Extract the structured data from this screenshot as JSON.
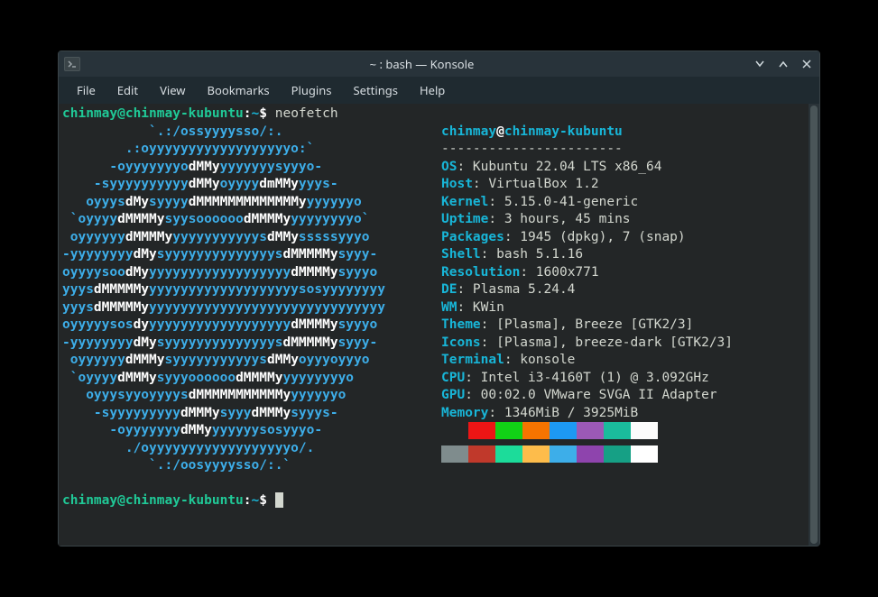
{
  "titlebar": {
    "title": "~ : bash — Konsole"
  },
  "menubar": {
    "items": [
      "File",
      "Edit",
      "View",
      "Bookmarks",
      "Plugins",
      "Settings",
      "Help"
    ]
  },
  "prompt": {
    "user": "chinmay",
    "at": "@",
    "host": "chinmay-kubuntu",
    "colon": ":",
    "path": "~",
    "dollar": "$ ",
    "command": "neofetch"
  },
  "ascii": [
    "           `.:/ossyyyysso/:.               ",
    "        .:oyyyyyyyyyyyyyyyyyyo:`           ",
    "      -oyyyyyyyo|dMMy|yyyyyyysyyyo-        ",
    "    -syyyyyyyyyy|dMMy|oyyyy|dmMMy|yyys-    ",
    "   oyyys|dMy|syyyy|dMMMMMMMMMMMMMy|yyyyyyo ",
    " `oyyyy|dMMMMy|syysoooooo|dMMMMy|yyyyyyyyo`",
    " oyyyyyy|dMMMMy|yyyyyyyyyyys|dMMy|sssssyyyo",
    "-yyyyyyyy|dMy|syyyyyyyyyyyyyys|dMMMMMy|syyy-",
    "oyyyysoo|dMy|yyyyyyyyyyyyyyyyyy|dMMMMy|syyyo",
    "yyys|dMMMMMy|yyyyyyyyyyyyyyyyyyysosyyyyyyyy",
    "yyys|dMMMMMy|yyyyyyyyyyyyyyyyyyyyyyyyyyyyyy",
    "oyyyyysos|dy|yyyyyyyyyyyyyyyyyy|dMMMMy|syyyo",
    "-yyyyyyyy|dMy|syyyyyyyyyyyyyys|dMMMMMy|syyy-",
    " oyyyyyy|dMMMy|syyyyyyyyyyys|dMMy|oyyyoyyyo",
    " `oyyyy|dMMMy|syyyoooooo|dMMMMy|yyyyyyyyo  ",
    "   oyyysyyoyyyys|dMMMMMMMMMMMy|yyyyyyo     ",
    "    -syyyyyyyyy|dMMMy|syyy|dMMMy|syyys-    ",
    "      -oyyyyyyy|dMMy|yyyyyysosyyyo-        ",
    "        ./oyyyyyyyyyyyyyyyyyyo/.           ",
    "           `.:/oosyyyysso/:.`              "
  ],
  "neofetch": {
    "user": "chinmay",
    "at": "@",
    "host": "chinmay-kubuntu",
    "sep": "-----------------------",
    "OS": "Kubuntu 22.04 LTS x86_64",
    "Host": "VirtualBox 1.2",
    "Kernel": "5.15.0-41-generic",
    "Uptime": "3 hours, 45 mins",
    "Packages": "1945 (dpkg), 7 (snap)",
    "Shell": "bash 5.1.16",
    "Resolution": "1600x771",
    "DE": "Plasma 5.24.4",
    "WM": "KWin",
    "Theme": "[Plasma], Breeze [GTK2/3]",
    "Icons": "[Plasma], breeze-dark [GTK2/3]",
    "Terminal": "konsole",
    "CPU": "Intel i3-4160T (1) @ 3.092GHz",
    "GPU": "00:02.0 VMware SVGA II Adapter",
    "Memory": "1346MiB / 3925MiB"
  },
  "palette": {
    "row1": [
      "#232627",
      "#ed1515",
      "#11d116",
      "#f67400",
      "#1d99f3",
      "#9b59b6",
      "#1abc9c",
      "#fcfcfc"
    ],
    "row2": [
      "#7f8c8d",
      "#c0392b",
      "#1cdc9a",
      "#fdbc4b",
      "#3daee9",
      "#8e44ad",
      "#16a085",
      "#ffffff"
    ]
  }
}
